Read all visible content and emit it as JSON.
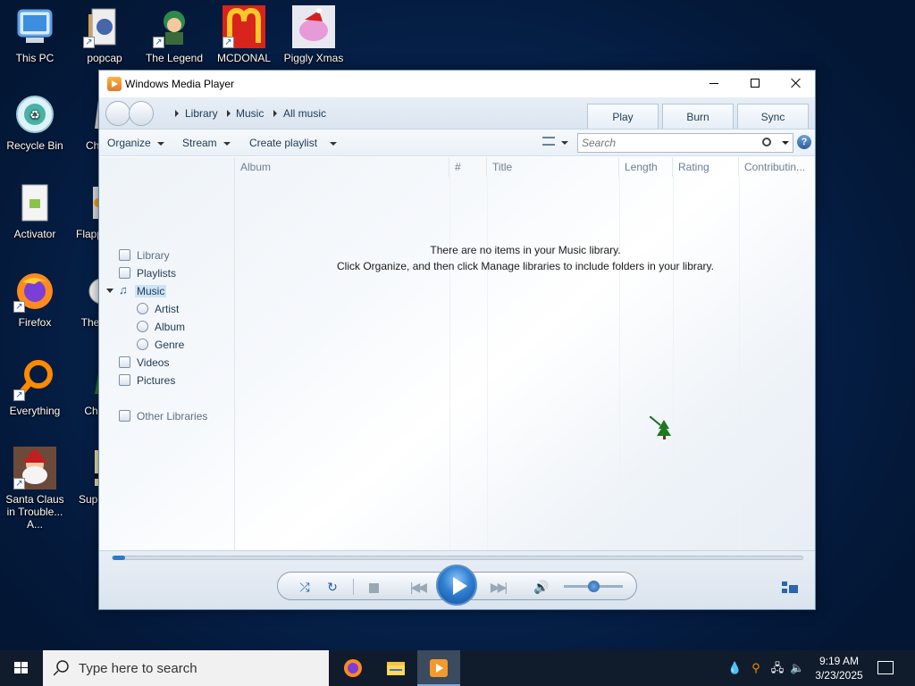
{
  "desktop": {
    "icons": [
      {
        "label": "This PC",
        "icon": "computer-icon"
      },
      {
        "label": "popcap",
        "icon": "folder-icon"
      },
      {
        "label": "The Legend",
        "icon": "game-icon"
      },
      {
        "label": "MCDONAL",
        "icon": "mcdonalds-icon"
      },
      {
        "label": "Piggly Xmas",
        "icon": "pig-icon"
      },
      {
        "label": "Recycle Bin",
        "icon": "recycle-bin-icon"
      },
      {
        "label": "Ch",
        "icon": "game-icon"
      },
      {
        "label": "Activator",
        "icon": "activator-icon"
      },
      {
        "label": "Flapp",
        "icon": "game-icon"
      },
      {
        "label": "Firefox",
        "icon": "firefox-icon"
      },
      {
        "label": "The",
        "icon": "game-icon"
      },
      {
        "label": "Everything",
        "icon": "everything-icon"
      },
      {
        "label": "Chr",
        "icon": "game-icon"
      },
      {
        "label": "Santa Claus in Trouble... A...",
        "icon": "santa-icon"
      },
      {
        "label": "Supe",
        "icon": "game-icon"
      }
    ]
  },
  "window": {
    "title": "Windows Media Player",
    "breadcrumb": [
      "Library",
      "Music",
      "All music"
    ],
    "tabs": [
      "Play",
      "Burn",
      "Sync"
    ]
  },
  "toolbar": {
    "organize": "Organize",
    "stream": "Stream",
    "create_playlist": "Create playlist",
    "search_placeholder": "Search"
  },
  "navpane": {
    "items": [
      {
        "label": "Library",
        "icon": "library-icon"
      },
      {
        "label": "Playlists",
        "icon": "playlist-icon"
      },
      {
        "label": "Music",
        "icon": "music-icon"
      },
      {
        "label": "Artist",
        "icon": "artist-icon"
      },
      {
        "label": "Album",
        "icon": "album-icon"
      },
      {
        "label": "Genre",
        "icon": "genre-icon"
      },
      {
        "label": "Videos",
        "icon": "video-icon"
      },
      {
        "label": "Pictures",
        "icon": "pictures-icon"
      },
      {
        "label": "Other Libraries",
        "icon": "other-libraries-icon"
      }
    ]
  },
  "list": {
    "columns": [
      "Album",
      "#",
      "Title",
      "Length",
      "Rating",
      "Contributin..."
    ],
    "empty_line1": "There are no items in your Music library.",
    "empty_line2": "Click Organize, and then click Manage libraries to include folders in your library."
  },
  "playback": {
    "seek_fraction": 0,
    "volume_fraction": 0.5
  },
  "taskbar": {
    "search_placeholder": "Type here to search",
    "time": "9:19 AM",
    "date": "3/23/2025"
  },
  "colors": {
    "accent": "#2f7fd2",
    "desktop": "#06224c",
    "taskbar": "#101c2c"
  }
}
